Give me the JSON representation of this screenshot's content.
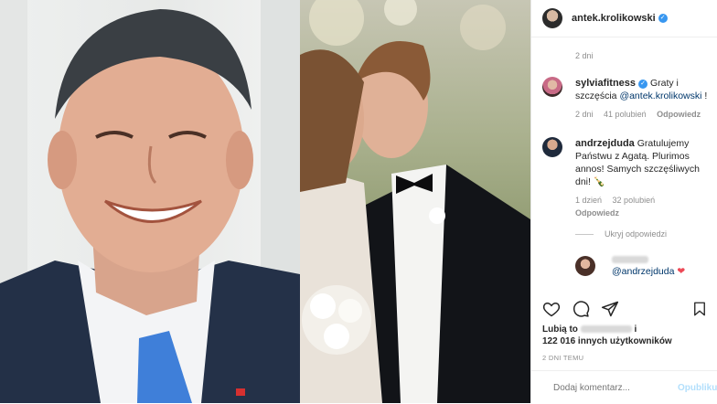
{
  "post": {
    "author": "antek.krolikowski",
    "time_header": "2 dni",
    "comments": [
      {
        "user": "sylviafitness",
        "text": "Graty i szczęścia",
        "mention": "@antek.krolikowski",
        "suffix": " !",
        "time": "2 dni",
        "likes": "41 polubień",
        "reply": "Odpowiedz"
      },
      {
        "user": "andrzejduda",
        "text": "Gratulujemy Państwu z Agatą. Plurimos annos! Samych szczęśliwych dni! 🍾",
        "time": "1 dzień",
        "likes": "32 polubień",
        "reply": "Odpowiedz"
      }
    ],
    "hide_replies": "Ukryj odpowiedzi",
    "reply_mention": "@andrzejduda",
    "reply_heart": "❤",
    "likes_prefix": "Lubią to",
    "likes_conj": "i",
    "likes_count": "122 016 innych użytkowników",
    "post_time": "2 DNI TEMU",
    "comment_placeholder": "Dodaj komentarz...",
    "publish": "Opublikuj"
  },
  "icons": {
    "heart": "heart-icon",
    "comment": "comment-icon",
    "share": "share-icon",
    "bookmark": "bookmark-icon",
    "emoji": "emoji-icon"
  },
  "colors": {
    "verified": "#3897f0",
    "heart": "#ed4956",
    "publish": "#b2dffc"
  }
}
